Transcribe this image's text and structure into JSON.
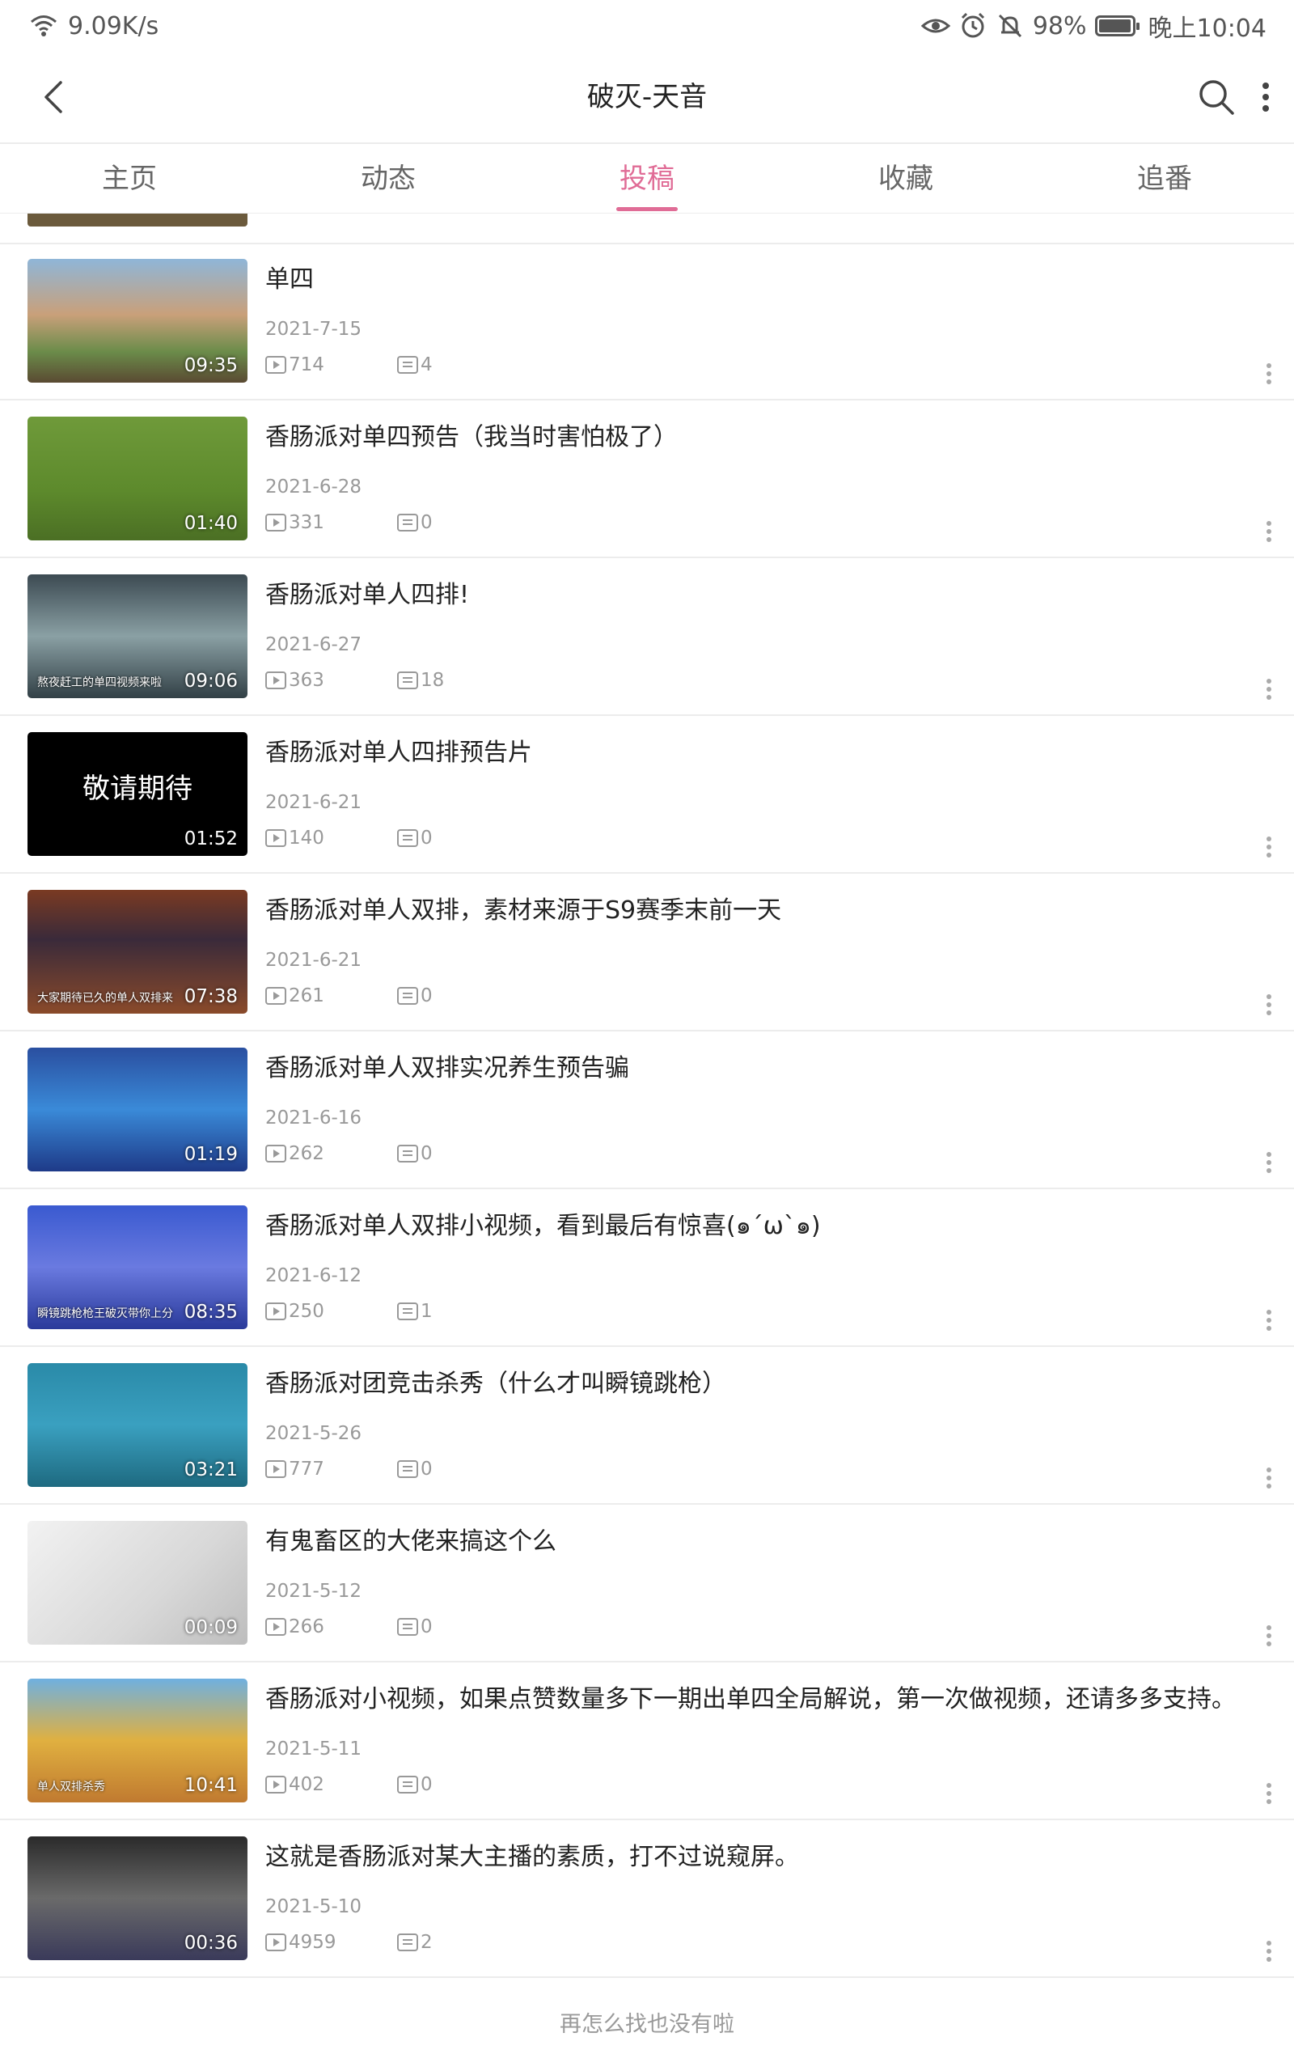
{
  "status_bar": {
    "net_speed": "9.09K/s",
    "battery": "98%",
    "battery_level": 0.98,
    "time": "晚上10:04",
    "icons": [
      "wifi-icon",
      "eye-icon",
      "alarm-icon",
      "mute-icon",
      "battery-icon"
    ]
  },
  "header": {
    "title": "破灭-天音",
    "back_icon": "chevron-left-icon",
    "search_icon": "search-icon",
    "more_icon": "more-vertical-icon"
  },
  "tabs": [
    {
      "label": "主页",
      "active": false
    },
    {
      "label": "动态",
      "active": false
    },
    {
      "label": "投稿",
      "active": true
    },
    {
      "label": "收藏",
      "active": false
    },
    {
      "label": "追番",
      "active": false
    }
  ],
  "videos": [
    {
      "title": "单四",
      "date": "2021-7-15",
      "plays": "714",
      "danmaku": "4",
      "duration": "09:35"
    },
    {
      "title": "香肠派对单四预告（我当时害怕极了）",
      "date": "2021-6-28",
      "plays": "331",
      "danmaku": "0",
      "duration": "01:40"
    },
    {
      "title": "香肠派对单人四排!",
      "date": "2021-6-27",
      "plays": "363",
      "danmaku": "18",
      "duration": "09:06",
      "caption": "熬夜赶工的单四视频来啦"
    },
    {
      "title": "香肠派对单人四排预告片",
      "date": "2021-6-21",
      "plays": "140",
      "danmaku": "0",
      "duration": "01:52",
      "thumb_text": "敬请期待"
    },
    {
      "title": "香肠派对单人双排，素材来源于S9赛季末前一天",
      "date": "2021-6-21",
      "plays": "261",
      "danmaku": "0",
      "duration": "07:38",
      "caption": "大家期待已久的单人双排来"
    },
    {
      "title": "香肠派对单人双排实况养生预告骗",
      "date": "2021-6-16",
      "plays": "262",
      "danmaku": "0",
      "duration": "01:19"
    },
    {
      "title": "香肠派对单人双排小视频，看到最后有惊喜(๑´ω`๑)",
      "date": "2021-6-12",
      "plays": "250",
      "danmaku": "1",
      "duration": "08:35",
      "caption": "瞬镜跳枪枪王破灭带你上分"
    },
    {
      "title": "香肠派对团竞击杀秀（什么才叫瞬镜跳枪）",
      "date": "2021-5-26",
      "plays": "777",
      "danmaku": "0",
      "duration": "03:21"
    },
    {
      "title": "有鬼畜区的大佬来搞这个么",
      "date": "2021-5-12",
      "plays": "266",
      "danmaku": "0",
      "duration": "00:09"
    },
    {
      "title": "香肠派对小视频，如果点赞数量多下一期出单四全局解说，第一次做视频，还请多多支持。",
      "date": "2021-5-11",
      "plays": "402",
      "danmaku": "0",
      "duration": "10:41",
      "caption": "单人双排杀秀"
    },
    {
      "title": "这就是香肠派对某大主播的素质，打不过说窥屏。",
      "date": "2021-5-10",
      "plays": "4959",
      "danmaku": "2",
      "duration": "00:36"
    }
  ],
  "footer": {
    "end_text": "再怎么找也没有啦"
  },
  "colors": {
    "accent": "#e06c96",
    "divider": "#ececec",
    "meta_text": "#999999"
  }
}
